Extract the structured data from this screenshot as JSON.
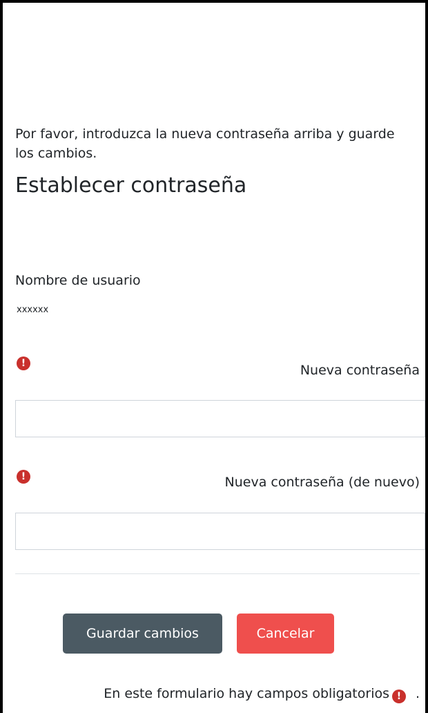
{
  "form": {
    "instructions": "Por favor, introduzca la nueva contraseña arriba y guarde los cambios.",
    "title": "Establecer contraseña",
    "username_label": "Nombre de usuario",
    "username_value": "xxxxxx",
    "new_password_label": "Nueva contraseña",
    "new_password_value": "",
    "confirm_password_label": "Nueva contraseña (de nuevo)",
    "confirm_password_value": "",
    "save_label": "Guardar cambios",
    "cancel_label": "Cancelar",
    "required_note": "En este formulario hay campos obligatorios",
    "required_note_end": ".",
    "required_icon": "!"
  },
  "icons": {
    "required": "exclamation-circle-icon"
  },
  "colors": {
    "required_icon": "#c9302c",
    "save_button": "#4b5a63",
    "cancel_button": "#ef4f4d"
  }
}
